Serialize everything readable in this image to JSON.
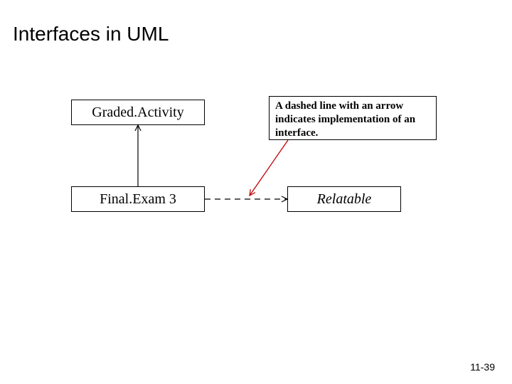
{
  "title": "Interfaces in UML",
  "boxes": {
    "graded_activity": "Graded.Activity",
    "final_exam": "Final.Exam 3",
    "relatable": "Relatable"
  },
  "note": "A dashed line with an arrow indicates implementation of an interface.",
  "page_number": "11-39"
}
